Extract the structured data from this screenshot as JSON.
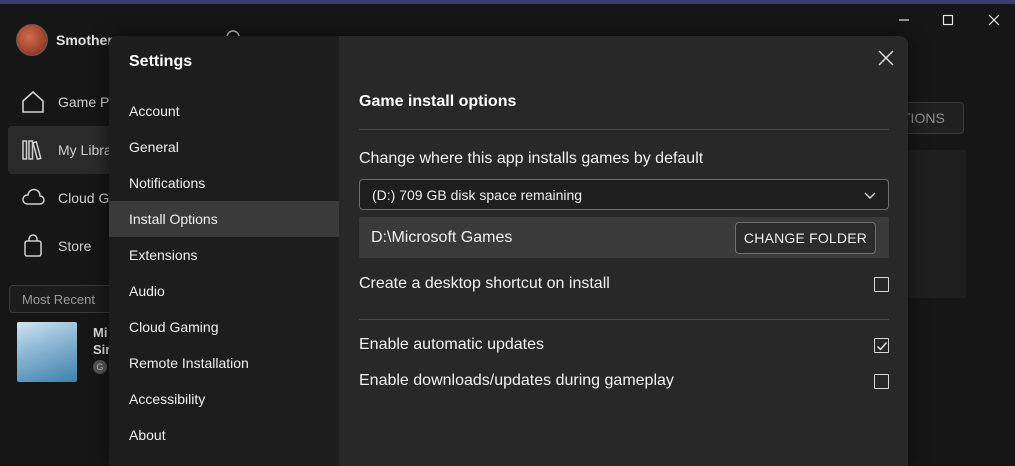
{
  "window": {
    "minimize_glyph": "—",
    "maximize_glyph": "☐",
    "close_glyph": "✕"
  },
  "background": {
    "user_name": "Smothery",
    "nav": [
      {
        "label": "Game Pa",
        "icon": "home-icon"
      },
      {
        "label": "My Libra",
        "icon": "library-icon"
      },
      {
        "label": "Cloud G",
        "icon": "cloud-icon"
      },
      {
        "label": "Store",
        "icon": "store-icon"
      }
    ],
    "recent_label": "Most Recent",
    "game_title_line1": "Mi",
    "game_title_line2": "Sir",
    "game_badge": "G",
    "options_label": "TIONS"
  },
  "settings": {
    "title": "Settings",
    "nav_items": [
      "Account",
      "General",
      "Notifications",
      "Install Options",
      "Extensions",
      "Audio",
      "Cloud Gaming",
      "Remote Installation",
      "Accessibility",
      "About"
    ],
    "active_item": "Install Options",
    "section_heading": "Game install options",
    "location_label": "Change where this app installs games by default",
    "drive_selected": "(D:) 709 GB disk space remaining",
    "install_path": "D:\\Microsoft Games",
    "change_folder_label": "CHANGE FOLDER",
    "options": [
      {
        "label": "Create a desktop shortcut on install",
        "checked": false
      },
      {
        "label": "Enable automatic updates",
        "checked": true
      },
      {
        "label": "Enable downloads/updates during gameplay",
        "checked": false
      }
    ]
  },
  "colors": {
    "modal_sidebar": "#1d1d1d",
    "modal_main": "#282828",
    "active_nav": "#3a3a3a"
  }
}
